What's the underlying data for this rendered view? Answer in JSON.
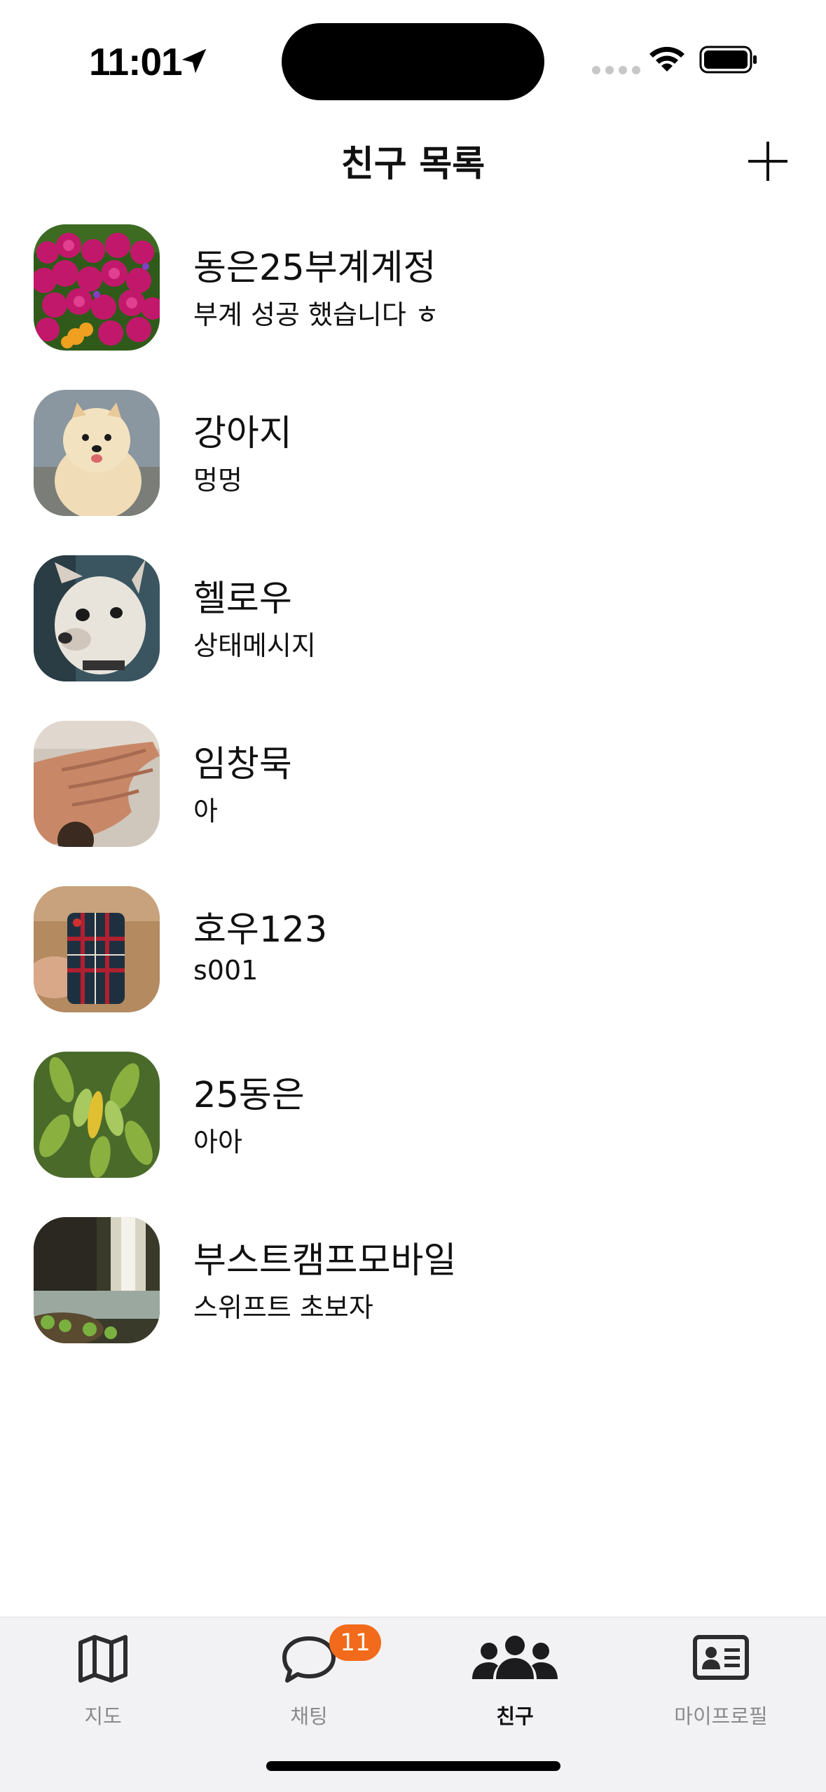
{
  "status_bar": {
    "time": "11:01"
  },
  "nav": {
    "title": "친구 목록",
    "add_icon": "plus-icon"
  },
  "friends": [
    {
      "name": "동은25부계계정",
      "status": "부계 성공 했습니다 ㅎ",
      "avatar": "flowers-photo"
    },
    {
      "name": "강아지",
      "status": "멍멍",
      "avatar": "pomeranian-photo"
    },
    {
      "name": "헬로우",
      "status": "상태메시지",
      "avatar": "chihuahua-photo"
    },
    {
      "name": "임창묵",
      "status": "아",
      "avatar": "hand-photo"
    },
    {
      "name": "호우123",
      "status": "s001",
      "avatar": "phone-case-photo"
    },
    {
      "name": "25동은",
      "status": "아아",
      "avatar": "leaves-photo"
    },
    {
      "name": "부스트캠프모바일",
      "status": "스위프트 초보자",
      "avatar": "waterfall-photo"
    }
  ],
  "tab_bar": {
    "tabs": [
      {
        "label": "지도",
        "icon": "map-icon",
        "active": false
      },
      {
        "label": "채팅",
        "icon": "chat-bubble-icon",
        "active": false,
        "badge": "11"
      },
      {
        "label": "친구",
        "icon": "people-icon",
        "active": true
      },
      {
        "label": "마이프로필",
        "icon": "profile-card-icon",
        "active": false
      }
    ]
  },
  "colors": {
    "badge": "#f26a1b",
    "tab_bar_bg": "#f2f2f4",
    "inactive_tab": "#8a8a8e"
  }
}
